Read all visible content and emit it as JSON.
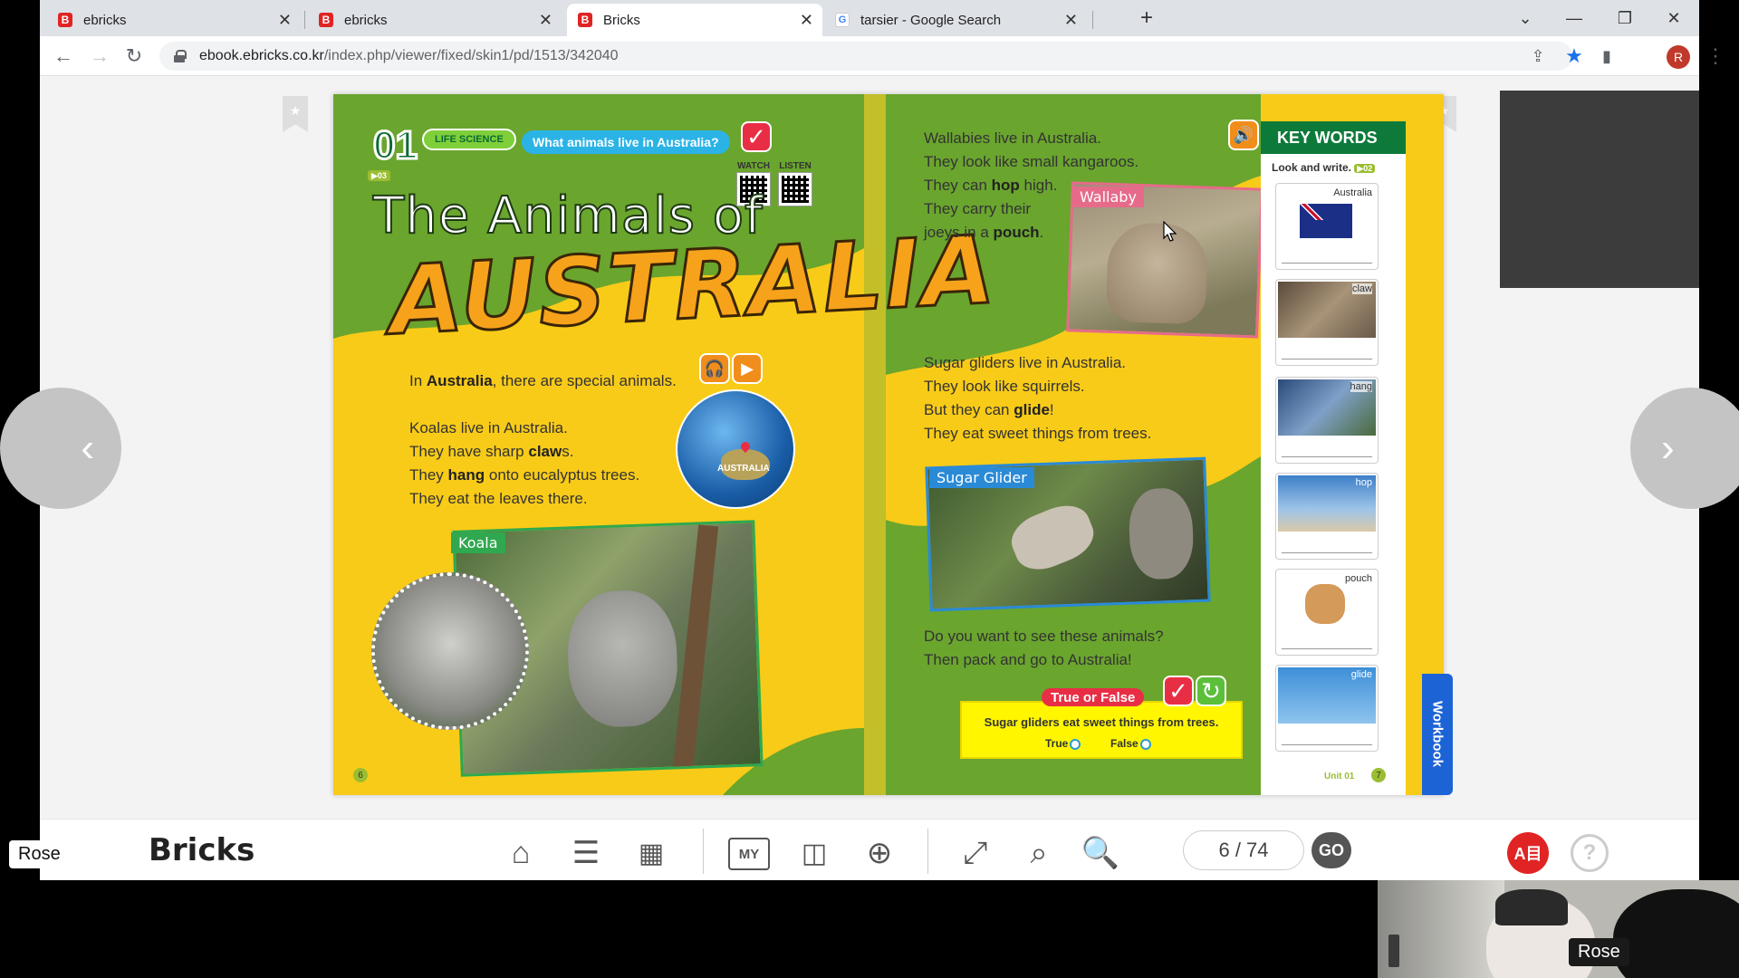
{
  "browser": {
    "tabs": [
      {
        "favicon": "B",
        "title": "ebricks",
        "active": false
      },
      {
        "favicon": "B",
        "title": "ebricks",
        "active": false
      },
      {
        "favicon": "B",
        "title": "Bricks",
        "active": true
      },
      {
        "favicon": "G",
        "title": "tarsier - Google Search",
        "active": false
      }
    ],
    "url_host": "ebook.ebricks.co.kr",
    "url_path": "/index.php/viewer/fixed/skin1/pd/1513/342040",
    "profile_initial": "R"
  },
  "book": {
    "unit_number": "01",
    "category": "LIFE SCIENCE",
    "question": "What animals live in Australia?",
    "track_left": "▶03",
    "qr_watch": "WATCH",
    "qr_listen": "LISTEN",
    "title_line1": "The Animals of",
    "title_line2": "AUSTRALIA",
    "intro_pre": "In ",
    "intro_bold": "Australia",
    "intro_post": ", there are special animals.",
    "globe_label": "AUSTRALIA",
    "koala_lines": [
      {
        "pre": "Koalas live in Australia.",
        "bold": "",
        "post": ""
      },
      {
        "pre": "They have sharp ",
        "bold": "claw",
        "post": "s."
      },
      {
        "pre": "They ",
        "bold": "hang",
        "post": " onto eucalyptus trees."
      },
      {
        "pre": "They eat the leaves there.",
        "bold": "",
        "post": ""
      }
    ],
    "koala_label": "Koala",
    "left_page_number": "6",
    "wallaby_lines": [
      {
        "pre": "Wallabies live in Australia.",
        "bold": "",
        "post": ""
      },
      {
        "pre": "They look like small kangaroos.",
        "bold": "",
        "post": ""
      },
      {
        "pre": "They can ",
        "bold": "hop",
        "post": " high."
      },
      {
        "pre": "They carry their",
        "bold": "",
        "post": ""
      },
      {
        "pre": "joeys in a ",
        "bold": "pouch",
        "post": "."
      }
    ],
    "wallaby_label": "Wallaby",
    "glider_lines": [
      {
        "pre": "Sugar gliders live in Australia.",
        "bold": "",
        "post": ""
      },
      {
        "pre": "They look like squirrels.",
        "bold": "",
        "post": ""
      },
      {
        "pre": "But they can ",
        "bold": "glide",
        "post": "!"
      },
      {
        "pre": "They eat sweet things from trees.",
        "bold": "",
        "post": ""
      }
    ],
    "glider_label": "Sugar Glider",
    "closing_1": "Do you want to see these animals?",
    "closing_2": "Then pack and go to Australia!",
    "tf_title": "True or False",
    "tf_statement": "Sugar gliders eat sweet things from trees.",
    "tf_true": "True",
    "tf_false": "False",
    "keywords_title": "KEY WORDS",
    "keywords_instruction": "Look and write.",
    "keywords_track": "▶02",
    "keywords": [
      "Australia",
      "claw",
      "hang",
      "hop",
      "pouch",
      "glide"
    ],
    "unit_footer": "Unit 01",
    "right_page_number": "7",
    "workbook_label": "Workbook"
  },
  "viewer": {
    "logo": "Bricks",
    "page_indicator": "6 / 74",
    "go_label": "GO",
    "user_badge": "A目"
  },
  "call": {
    "name_left": "Rose",
    "name_right": "Rose"
  },
  "colors": {
    "page_green": "#6aa52e",
    "page_yellow": "#f8cb18",
    "accent_red": "#e82e45",
    "brand_red": "#e02424"
  }
}
